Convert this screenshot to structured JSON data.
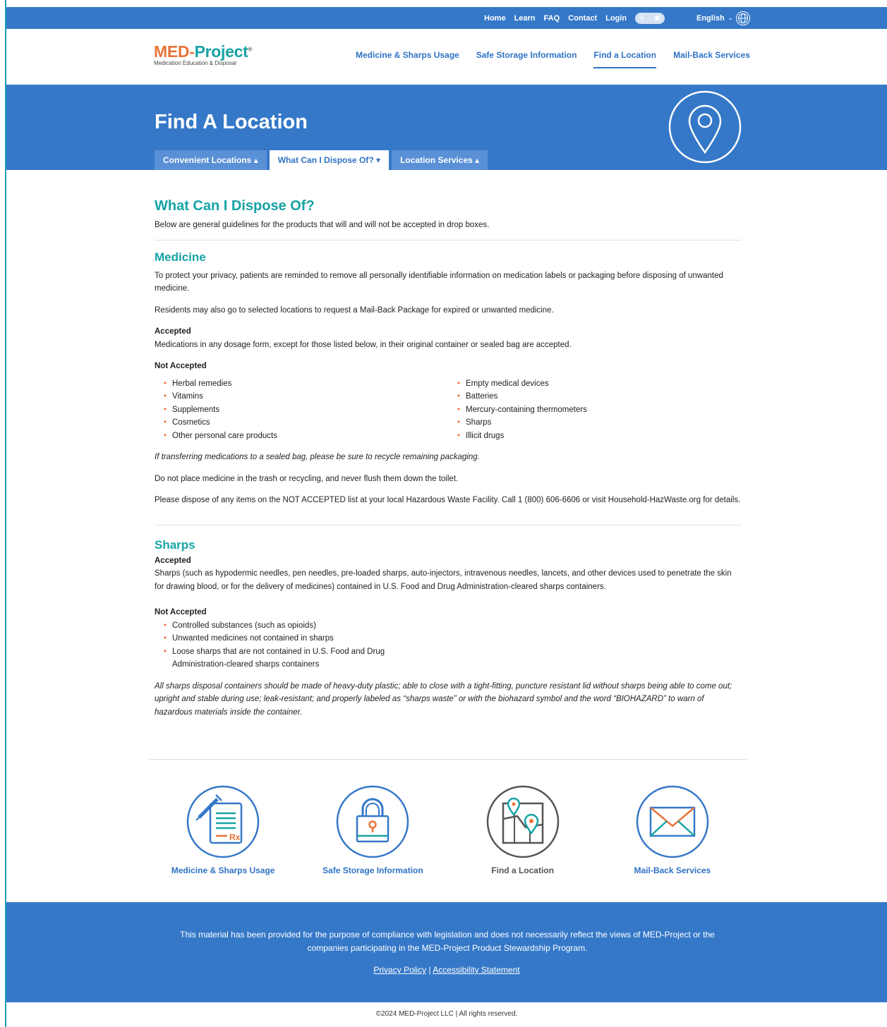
{
  "topbar": {
    "links": [
      "Home",
      "Learn",
      "FAQ",
      "Contact",
      "Login"
    ],
    "language": "English"
  },
  "logo": {
    "main_left": "MED-",
    "main_right": "Project",
    "registered": "®",
    "subtitle": "Medication Education & Disposal"
  },
  "mainnav": {
    "items": [
      "Medicine & Sharps Usage",
      "Safe Storage Information",
      "Find a Location",
      "Mail-Back Services"
    ]
  },
  "hero": {
    "title": "Find A Location",
    "tabs": [
      "Convenient Locations ▴",
      "What Can I Dispose Of? ▾",
      "Location Services ▴"
    ]
  },
  "content": {
    "title": "What Can I Dispose Of?",
    "intro": "Below are general guidelines for the products that will and will not be accepted in drop boxes.",
    "medicine": {
      "heading": "Medicine",
      "p1": "To protect your privacy, patients are reminded to remove all personally identifiable information on medication labels or packaging before disposing of unwanted medicine.",
      "p2": "Residents may also go to selected locations to request a Mail-Back Package for expired or unwanted medicine.",
      "accepted_label": "Accepted",
      "accepted_text": "Medications in any dosage form, except for those listed below, in their original container or sealed bag are accepted.",
      "not_accepted_label": "Not Accepted",
      "list_left": [
        "Herbal remedies",
        "Vitamins",
        "Supplements",
        "Cosmetics",
        "Other personal care products"
      ],
      "list_right": [
        "Empty medical devices",
        "Batteries",
        "Mercury-containing thermometers",
        "Sharps",
        "Illicit drugs"
      ],
      "note": "If transferring medications to a sealed bag, please be sure to recycle remaining packaging.",
      "p3": "Do not place medicine in the trash or recycling, and never flush them down the toilet.",
      "p4": "Please dispose of any items on the NOT ACCEPTED list at your local Hazardous Waste Facility. Call 1 (800) 606-6606 or visit Household-HazWaste.org for details."
    },
    "sharps": {
      "heading": "Sharps",
      "accepted_label": "Accepted",
      "accepted_text": "Sharps (such as hypodermic needles, pen needles, pre-loaded sharps, auto-injectors, intravenous needles, lancets, and other devices used to penetrate the skin for drawing blood, or for the delivery of medicines) contained in U.S. Food and Drug Administration-cleared sharps containers.",
      "not_accepted_label": "Not Accepted",
      "list": [
        "Controlled substances (such as opioids)",
        "Unwanted medicines not contained in sharps",
        "Loose sharps that are not contained in U.S. Food and Drug Administration-cleared sharps containers"
      ],
      "note": "All sharps disposal containers should be made of heavy-duty plastic; able to close with a tight-fitting, puncture resistant lid without sharps being able to come out; upright and stable during use; leak-resistant; and properly labeled as “sharps waste” or with the biohazard symbol and the word “BIOHAZARD” to warn of hazardous materials inside the container."
    }
  },
  "cards": [
    {
      "label": "Medicine & Sharps Usage",
      "icon": "prescription-syringe-icon"
    },
    {
      "label": "Safe Storage Information",
      "icon": "padlock-icon"
    },
    {
      "label": "Find a Location",
      "icon": "map-pin-icon"
    },
    {
      "label": "Mail-Back Services",
      "icon": "envelope-icon"
    }
  ],
  "footer": {
    "text": "This material has been provided for the purpose of compliance with legislation and does not necessarily reflect the views of MED-Project or the companies participating in the MED-Project Product Stewardship Program.",
    "privacy": "Privacy Policy",
    "separator": "|",
    "accessibility": "Accessibility Statement",
    "copyright": "©2024  MED-Project LLC | All rights reserved."
  },
  "colors": {
    "brand_blue": "#3578c8",
    "teal": "#17a3a4",
    "orange": "#e8743b"
  }
}
